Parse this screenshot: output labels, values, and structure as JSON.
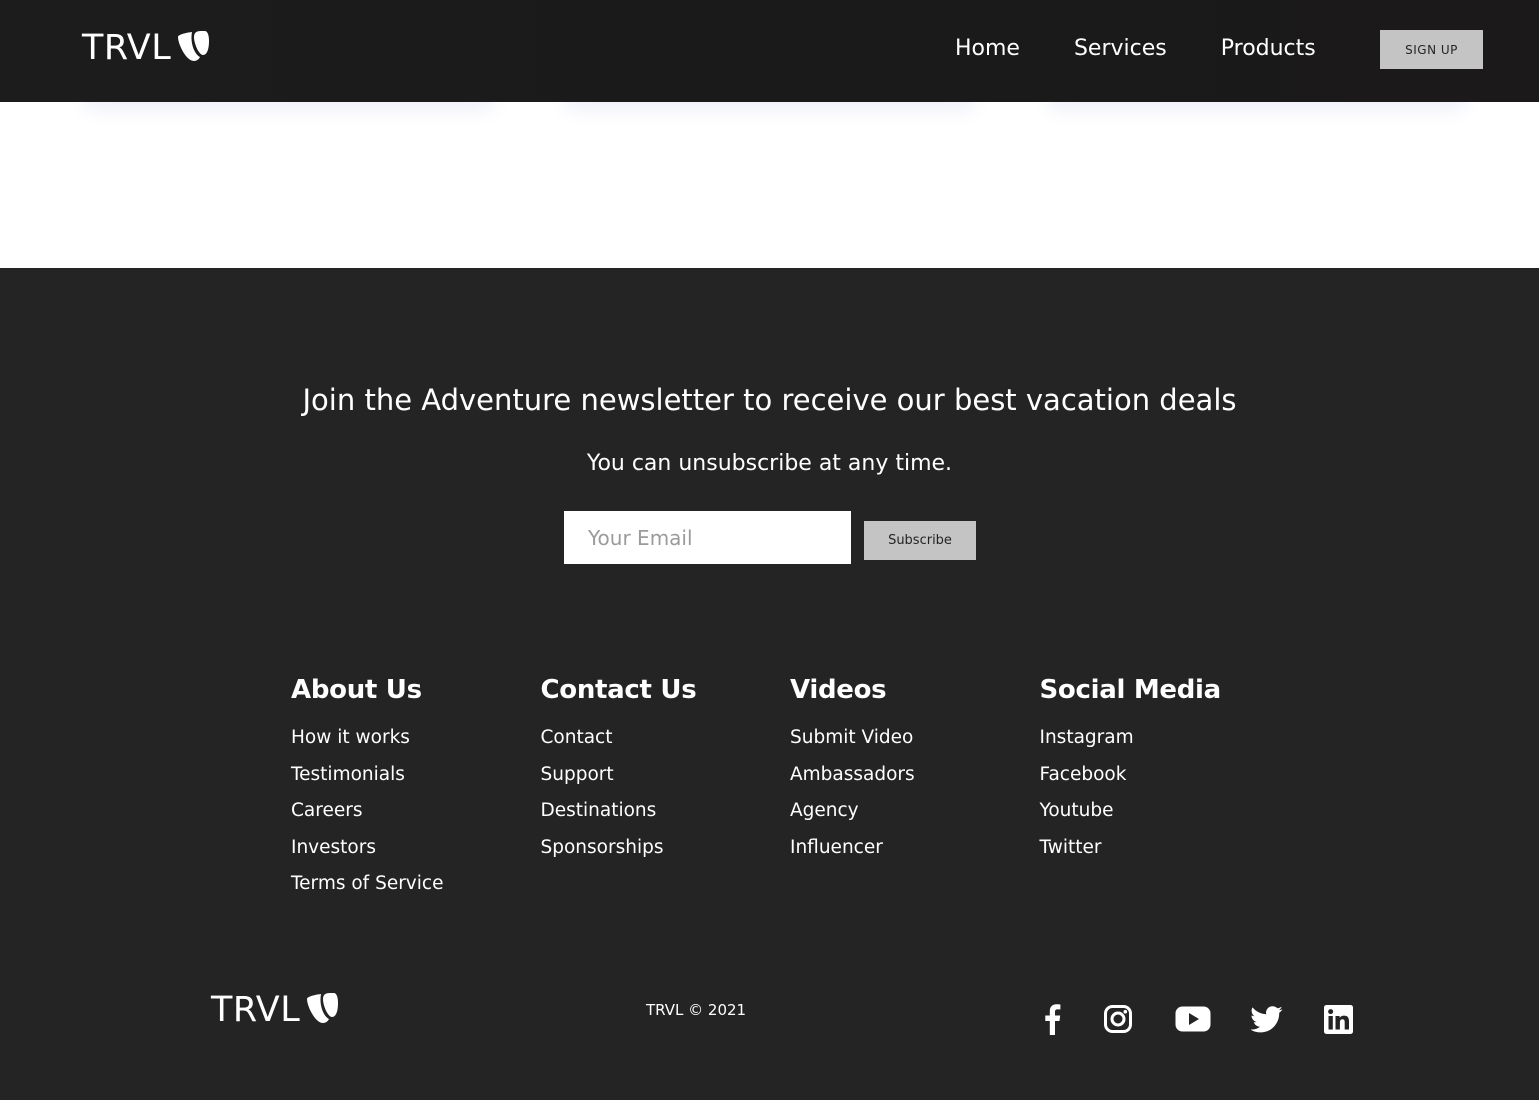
{
  "navbar": {
    "logo_text": "TRVL",
    "menu": [
      {
        "label": "Home"
      },
      {
        "label": "Services"
      },
      {
        "label": "Products"
      }
    ],
    "signup_label": "SIGN UP"
  },
  "newsletter": {
    "heading": "Join the Adventure newsletter to receive our best vacation deals",
    "subheading": "You can unsubscribe at any time.",
    "email_placeholder": "Your Email",
    "subscribe_label": "Subscribe"
  },
  "footer_columns": [
    {
      "title": "About Us",
      "links": [
        "How it works",
        "Testimonials",
        "Careers",
        "Investors",
        "Terms of Service"
      ]
    },
    {
      "title": "Contact Us",
      "links": [
        "Contact",
        "Support",
        "Destinations",
        "Sponsorships"
      ]
    },
    {
      "title": "Videos",
      "links": [
        "Submit Video",
        "Ambassadors",
        "Agency",
        "Influencer"
      ]
    },
    {
      "title": "Social Media",
      "links": [
        "Instagram",
        "Facebook",
        "Youtube",
        "Twitter"
      ]
    }
  ],
  "footer_bottom": {
    "logo_text": "TRVL",
    "copyright": "TRVL © 2021",
    "social_icons": [
      "facebook-icon",
      "instagram-icon",
      "youtube-icon",
      "twitter-icon",
      "linkedin-icon"
    ]
  },
  "colors": {
    "navbar_bg": "#1a1a1a",
    "footer_bg": "#242424",
    "button_bg": "#c4c4c4",
    "text": "#ffffff"
  }
}
